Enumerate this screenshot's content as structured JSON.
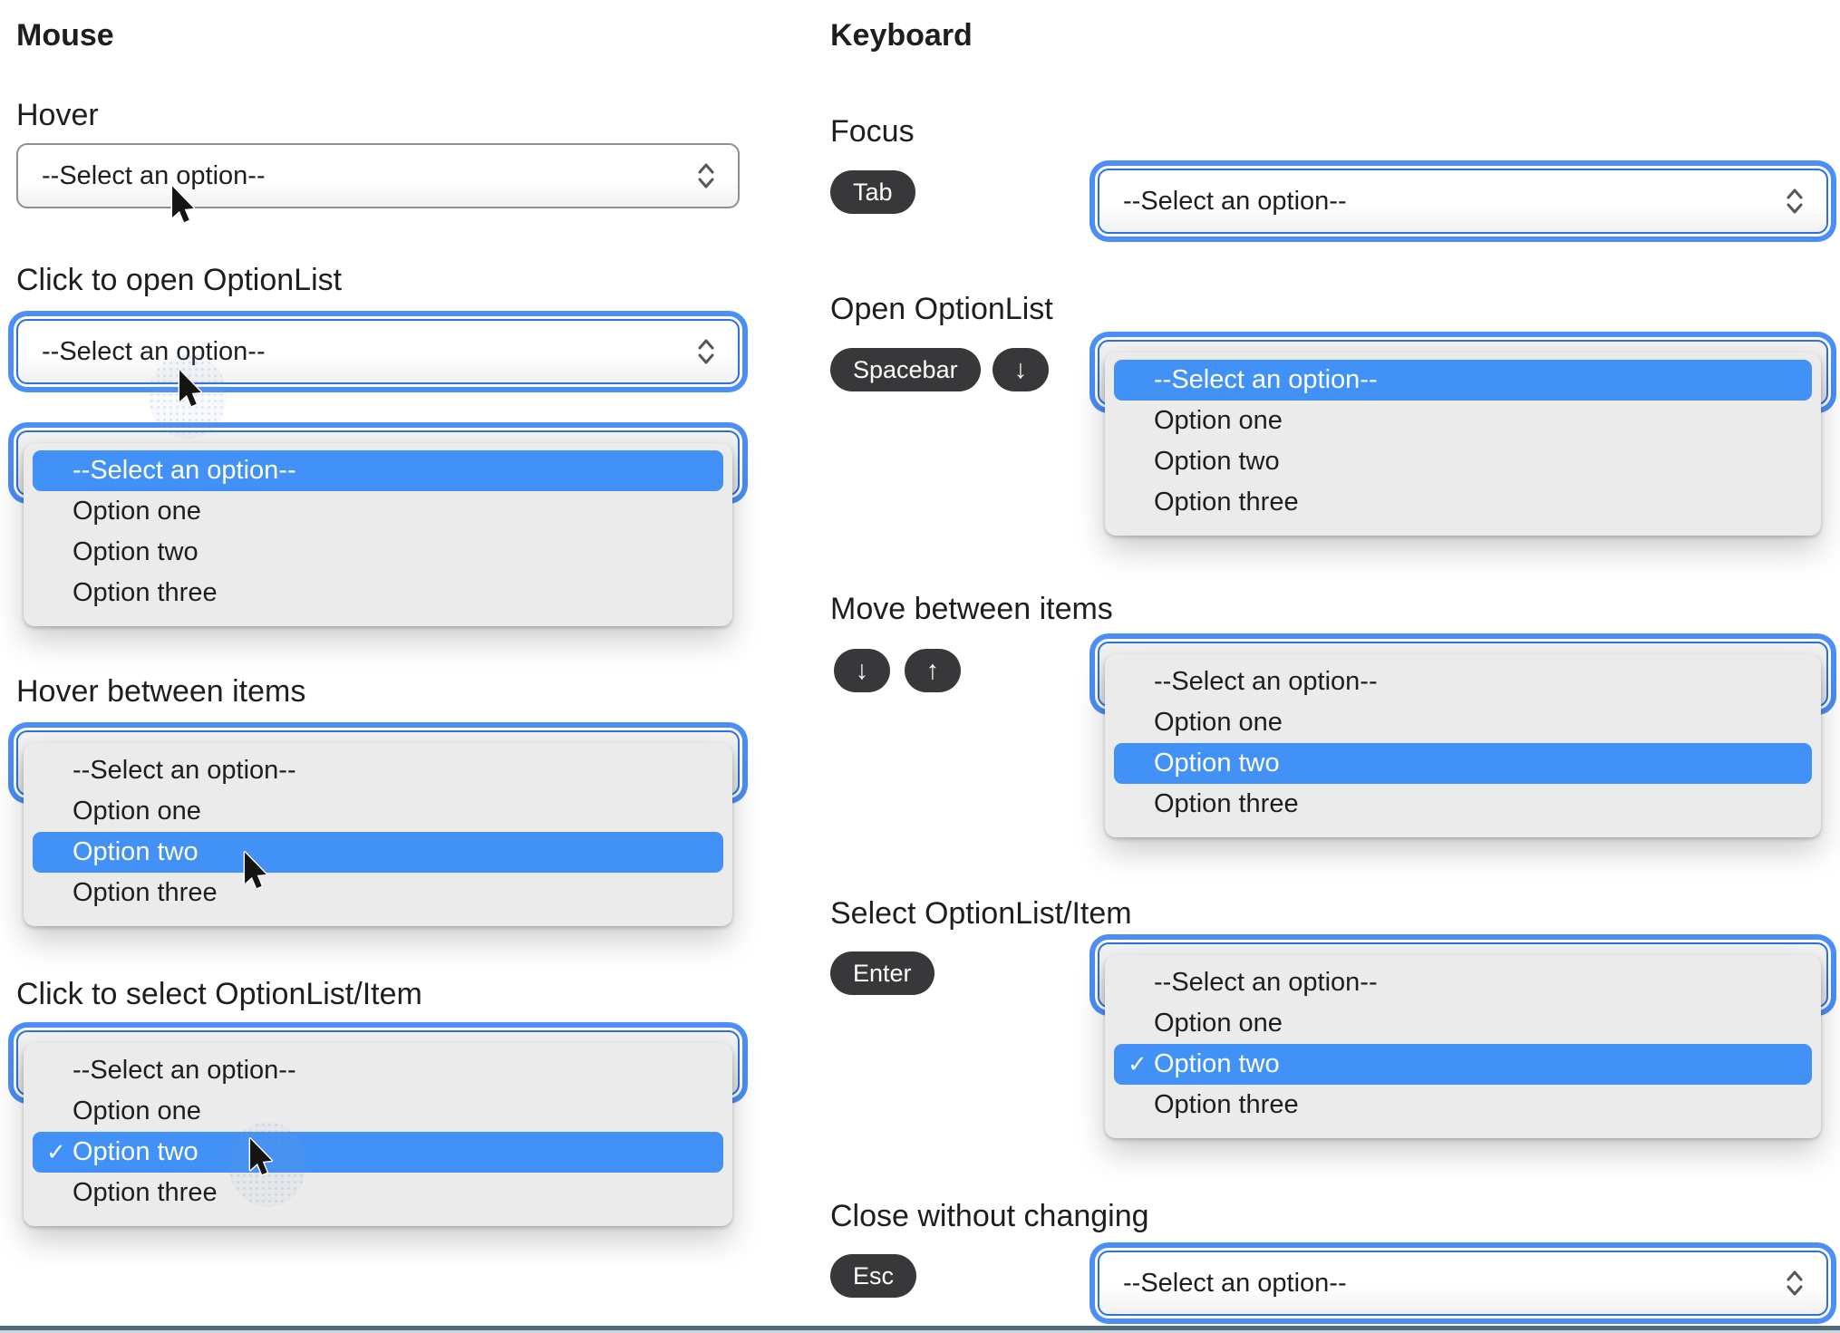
{
  "options": [
    "--Select an option--",
    "Option one",
    "Option two",
    "Option three"
  ],
  "select": {
    "placeholder": "--Select an option--"
  },
  "glyphs": {
    "check": "✓",
    "arrow_down": "↓",
    "arrow_up": "↑"
  },
  "colors": {
    "focus_ring": "#4b8ef7",
    "highlight": "#4191f6",
    "key_pill": "#38383a",
    "divider": "#51697d"
  },
  "mouse": {
    "title": "Mouse",
    "sections": {
      "hover": {
        "title": "Hover"
      },
      "click_open": {
        "title": "Click to open OptionList"
      },
      "hover_items": {
        "title": "Hover between items"
      },
      "click_select": {
        "title": "Click to select OptionList/Item"
      }
    }
  },
  "keyboard": {
    "title": "Keyboard",
    "sections": {
      "focus": {
        "title": "Focus",
        "keys": [
          "Tab"
        ]
      },
      "open": {
        "title": "Open OptionList",
        "keys": [
          "Spacebar",
          "↓"
        ]
      },
      "move": {
        "title": "Move between items",
        "keys": [
          "↓",
          "↑"
        ]
      },
      "select_item": {
        "title": "Select OptionList/Item",
        "keys": [
          "Enter"
        ]
      },
      "close": {
        "title": "Close without changing",
        "keys": [
          "Esc"
        ]
      }
    }
  }
}
